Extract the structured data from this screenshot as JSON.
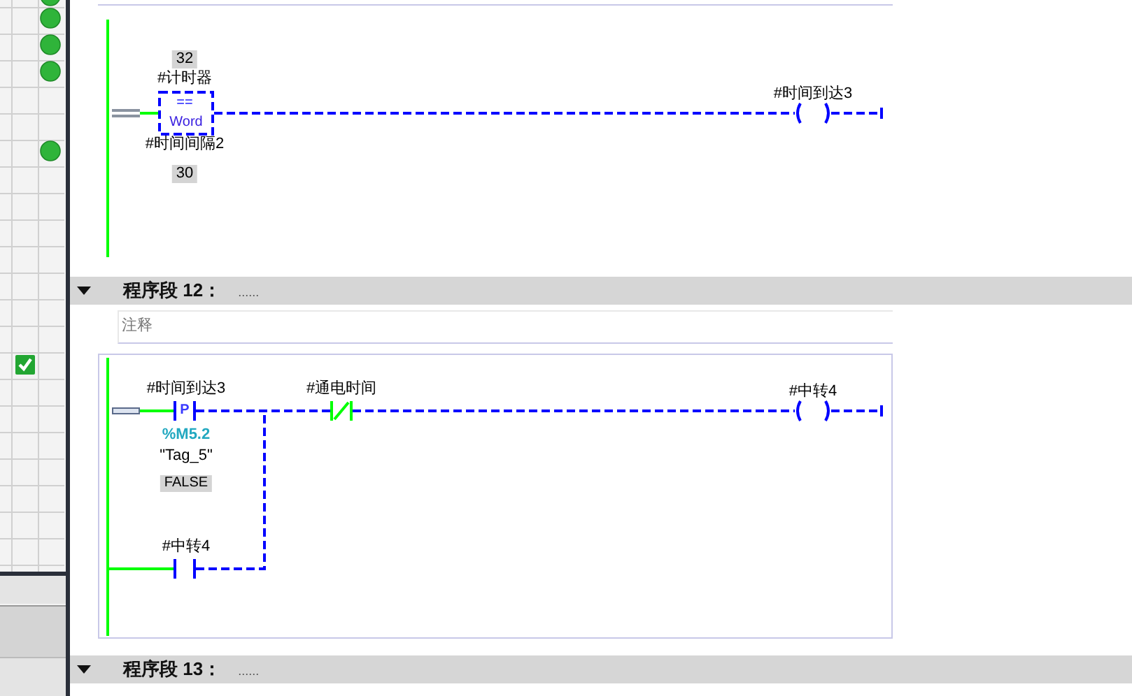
{
  "gutter_marks": [
    {
      "kind": "dot"
    },
    {
      "kind": "dot"
    },
    {
      "kind": "dot"
    },
    {
      "kind": "dot"
    },
    {
      "kind": "dot"
    },
    {
      "kind": "check"
    }
  ],
  "networks": [
    {
      "elements": [
        {
          "kind": "compare",
          "operator": "==",
          "type": "Word",
          "in1": "#计时器",
          "in1_value": "32",
          "in2": "#时间间隔2",
          "in2_value": "30",
          "energized": false
        },
        {
          "kind": "coil",
          "operand": "#时间到达3",
          "energized": false
        }
      ]
    },
    {
      "header": {
        "label": "程序段 12：",
        "comment": "......",
        "expanded": true
      },
      "comment_placeholder": "注释",
      "elements": [
        {
          "kind": "p_contact",
          "edge_type": "P",
          "operand": "#时间到达3",
          "address": "%M5.2",
          "tag": "\"Tag_5\"",
          "value": "FALSE",
          "energized": false
        },
        {
          "kind": "nc_contact",
          "operand": "#通电时间",
          "energized": true
        },
        {
          "kind": "coil",
          "operand": "#中转4",
          "energized": false
        },
        {
          "kind": "no_contact",
          "operand": "#中转4",
          "energized": false
        }
      ]
    },
    {
      "header": {
        "label": "程序段 13：",
        "comment": "......",
        "expanded": true
      }
    }
  ]
}
